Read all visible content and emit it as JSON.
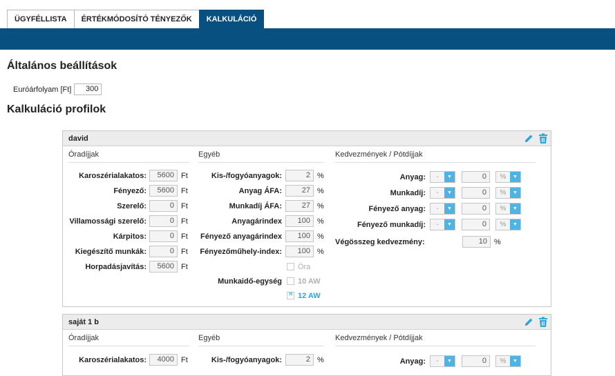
{
  "tabs": [
    {
      "label": "ÜGYFÉLLISTA",
      "active": false
    },
    {
      "label": "ÉRTÉKMÓDOSÍTÓ TÉNYEZŐK",
      "active": false
    },
    {
      "label": "KALKULÁCIÓ",
      "active": true
    }
  ],
  "general": {
    "title": "Általános beállítások",
    "euro_label": "Euróárfolyam [Ft]",
    "euro_value": "300"
  },
  "profiles_title": "Kalkuláció profilok",
  "profiles": [
    {
      "name": "david",
      "sections": {
        "hourly": "Óradíjjak",
        "other": "Egyéb",
        "discounts": "Kedvezmények / Pótdíjjak"
      },
      "hourly": [
        {
          "label": "Karoszérialakatos:",
          "value": "5600",
          "unit": "Ft"
        },
        {
          "label": "Fényező:",
          "value": "5600",
          "unit": "Ft"
        },
        {
          "label": "Szerelő:",
          "value": "0",
          "unit": "Ft"
        },
        {
          "label": "Villamossági szerelő:",
          "value": "0",
          "unit": "Ft"
        },
        {
          "label": "Kárpitos:",
          "value": "0",
          "unit": "Ft"
        },
        {
          "label": "Kiegészítő munkák:",
          "value": "0",
          "unit": "Ft"
        },
        {
          "label": "Horpadásjavítás:",
          "value": "5600",
          "unit": "Ft"
        }
      ],
      "other": [
        {
          "label": "Kis-/fogyóanyagok:",
          "value": "2",
          "unit": "%"
        },
        {
          "label": "Anyag ÁFA:",
          "value": "27",
          "unit": "%"
        },
        {
          "label": "Munkadíj ÁFA:",
          "value": "27",
          "unit": "%"
        },
        {
          "label": "Anyagárindex",
          "value": "100",
          "unit": "%"
        },
        {
          "label": "Fényező anyagárindex",
          "value": "100",
          "unit": "%"
        },
        {
          "label": "Fényezőműhely-index:",
          "value": "100",
          "unit": "%"
        }
      ],
      "time_unit": {
        "label": "Munkaidő-egység",
        "options": [
          {
            "label": "Óra",
            "checked": false
          },
          {
            "label": "10 AW",
            "checked": false
          },
          {
            "label": "12 AW",
            "checked": true
          }
        ]
      },
      "discounts": [
        {
          "label": "Anyag:",
          "sign": "-",
          "value": "0",
          "unit": "%"
        },
        {
          "label": "Munkadíj:",
          "sign": "-",
          "value": "0",
          "unit": "%"
        },
        {
          "label": "Fényező anyag:",
          "sign": "-",
          "value": "0",
          "unit": "%"
        },
        {
          "label": "Fényező munkadíj:",
          "sign": "-",
          "value": "0",
          "unit": "%"
        }
      ],
      "total_discount": {
        "label": "Végösszeg kedvezmény:",
        "value": "10",
        "unit": "%"
      }
    },
    {
      "name": "saját 1 b",
      "sections": {
        "hourly": "Óradíjjak",
        "other": "Egyéb",
        "discounts": "Kedvezmények / Pótdíjjak"
      },
      "hourly": [
        {
          "label": "Karoszérialakatos:",
          "value": "4000",
          "unit": "Ft"
        }
      ],
      "other": [
        {
          "label": "Kis-/fogyóanyagok:",
          "value": "2",
          "unit": "%"
        }
      ],
      "discounts": [
        {
          "label": "Anyag:",
          "sign": "-",
          "value": "0",
          "unit": "%"
        }
      ]
    }
  ],
  "colors": {
    "header_blue": "#08507f",
    "accent": "#4fb3e3"
  },
  "icons": {
    "edit": "pencil-icon",
    "delete": "trash-icon"
  }
}
